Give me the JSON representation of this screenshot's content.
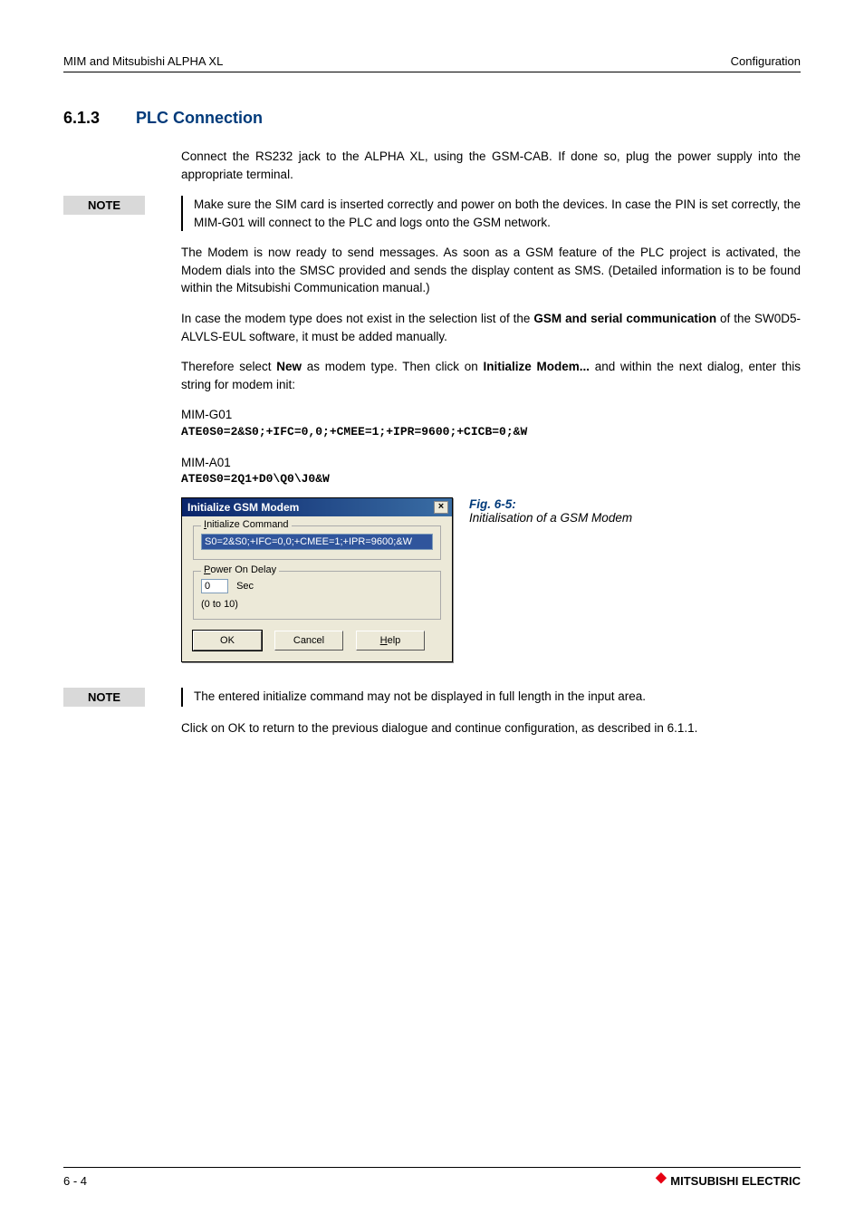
{
  "header": {
    "left": "MIM and Mitsubishi ALPHA XL",
    "right": "Configuration"
  },
  "section": {
    "number": "6.1.3",
    "title": "PLC Connection"
  },
  "paras": {
    "p1": "Connect the RS232 jack to the ALPHA XL, using the GSM-CAB. If done so, plug the power supply into the appropriate terminal.",
    "note1": "Make sure the SIM card is inserted correctly and power on both the devices. In case the PIN is set correctly, the MIM-G01 will connect to the PLC and logs onto the GSM network.",
    "p2": "The Modem is now ready to send messages. As soon as a GSM feature of the PLC project is activated, the Modem dials into the SMSC provided and sends the display content as SMS. (Detailed information is to be found within the Mitsubishi Communication manual.)",
    "p3a": "In case the modem type does not exist in the selection list of the ",
    "p3b": "GSM and serial communication",
    "p3c": " of the  SW0D5-ALVLS-EUL software, it must be added manually.",
    "p4a": "Therefore select ",
    "p4b": "New",
    "p4c": " as modem type. Then click on ",
    "p4d": "Initialize Modem...",
    "p4e": " and within the next dialog, enter this string for modem init:",
    "l1": "MIM-G01",
    "c1": "ATE0S0=2&S0;+IFC=0,0;+CMEE=1;+IPR=9600;+CICB=0;&W",
    "l2": "MIM-A01",
    "c2": "ATE0S0=2Q1+D0\\Q0\\J0&W",
    "note2": "The entered initialize command may not be displayed in full length in the input area.",
    "p5": "Click on OK to return to the previous dialogue and continue configuration, as described in 6.1.1."
  },
  "dialog": {
    "title": "Initialize GSM Modem",
    "close": "×",
    "group1": "Initialize Command",
    "input": "S0=2&S0;+IFC=0,0;+CMEE=1;+IPR=9600;&W",
    "group2_pre": "P",
    "group2_rest": "ower On Delay",
    "secVal": "0",
    "secLabel": "Sec",
    "range": "(0 to 10)",
    "ok": "OK",
    "cancel": "Cancel",
    "help_pre": "H",
    "help_rest": "elp"
  },
  "caption": {
    "title": "Fig. 6-5:",
    "sub": "Initialisation of a GSM Modem"
  },
  "note_label": "NOTE",
  "footer": {
    "page": "6 - 4",
    "brand": "MITSUBISHI ELECTRIC"
  }
}
